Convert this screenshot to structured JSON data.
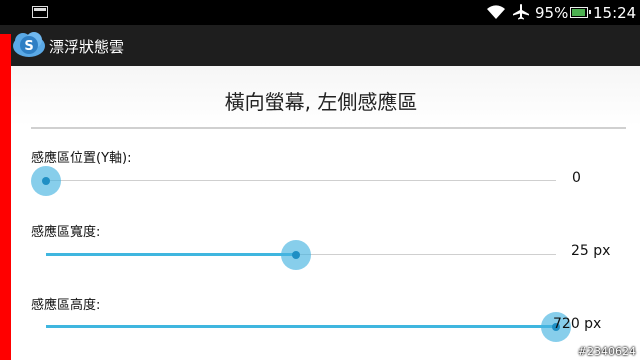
{
  "status_bar": {
    "battery_percent_label": "95%",
    "battery_level": 0.95,
    "time": "15:24",
    "icons": [
      "notification-icon",
      "wifi-icon",
      "airplane-icon",
      "battery-icon"
    ]
  },
  "action_bar": {
    "app_icon": "app-logo-icon",
    "title": "漂浮狀態雲"
  },
  "edge_strip_color": "#ff0000",
  "accent_color": "#3fb6df",
  "section": {
    "title": "橫向螢幕, 左側感應區"
  },
  "settings": [
    {
      "label": "感應區位置(Y軸):",
      "value_text": "0",
      "fraction": 0.0
    },
    {
      "label": "感應區寬度:",
      "value_text": "25 px",
      "fraction": 0.49
    },
    {
      "label": "感應區高度:",
      "value_text": "720 px",
      "fraction": 1.0
    }
  ],
  "watermark": "#2340624"
}
